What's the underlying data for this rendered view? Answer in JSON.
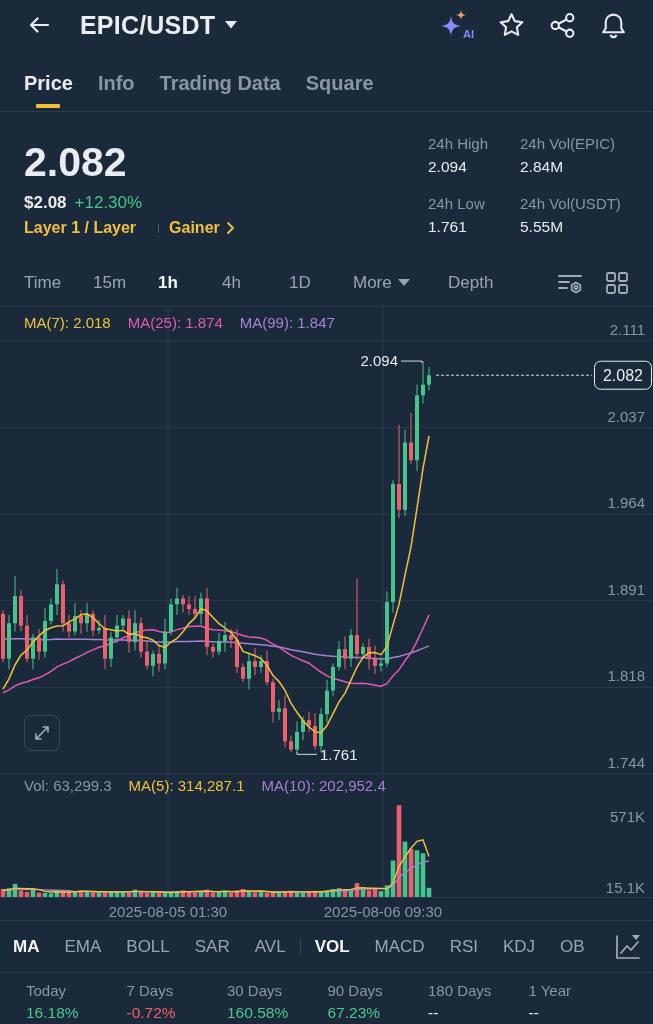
{
  "header": {
    "title": "EPIC/USDT",
    "ai_label": "AI"
  },
  "tabs": [
    {
      "label": "Price",
      "selected": true
    },
    {
      "label": "Info",
      "selected": false
    },
    {
      "label": "Trading Data",
      "selected": false
    },
    {
      "label": "Square",
      "selected": false
    }
  ],
  "ticker": {
    "last_price": "2.082",
    "fiat_price": "$2.08",
    "change": {
      "text": "+12.30%",
      "color": "#45c48b"
    },
    "tags": [
      {
        "label": "Layer 1 / Layer",
        "kind": "category"
      },
      {
        "label": "Gainer",
        "kind": "link"
      }
    ]
  },
  "stats": [
    {
      "label": "24h High",
      "value": "2.094"
    },
    {
      "label": "24h Vol(EPIC)",
      "value": "2.84M"
    },
    {
      "label": "24h Low",
      "value": "1.761"
    },
    {
      "label": "24h Vol(USDT)",
      "value": "5.55M"
    }
  ],
  "intervals": [
    {
      "label": "Time",
      "selected": false,
      "kind": "option"
    },
    {
      "label": "15m",
      "selected": false,
      "kind": "option"
    },
    {
      "label": "1h",
      "selected": true,
      "kind": "option"
    },
    {
      "label": "4h",
      "selected": false,
      "kind": "option"
    },
    {
      "label": "1D",
      "selected": false,
      "kind": "option"
    },
    {
      "label": "More",
      "selected": false,
      "kind": "dropdown"
    },
    {
      "label": "Depth",
      "selected": false,
      "kind": "option"
    }
  ],
  "price_chart": {
    "legend": [
      {
        "text": "MA(7): 2.018",
        "color": "#f0c23a"
      },
      {
        "text": "MA(25): 1.874",
        "color": "#e25ab5"
      },
      {
        "text": "MA(99): 1.847",
        "color": "#a681d4"
      }
    ],
    "axis_labels": [
      "2.111",
      "2.037",
      "1.964",
      "1.891",
      "1.818",
      "1.744"
    ],
    "high_label": "2.094",
    "low_label": "1.761",
    "current_price": "2.082"
  },
  "volume_chart": {
    "legend": [
      {
        "text": "Vol: 63,299.3",
        "color": "#8a96a3"
      },
      {
        "text": "MA(5): 314,287.1",
        "color": "#f0c23a"
      },
      {
        "text": "MA(10): 202,952.4",
        "color": "#a681d4"
      }
    ],
    "axis_labels": [
      "571K",
      "15.1K"
    ],
    "time_labels": [
      "2025-08-05 01:30",
      "2025-08-06 09:30"
    ]
  },
  "indicators": {
    "main": [
      {
        "label": "MA",
        "selected": true
      },
      {
        "label": "EMA",
        "selected": false
      },
      {
        "label": "BOLL",
        "selected": false
      },
      {
        "label": "SAR",
        "selected": false
      },
      {
        "label": "AVL",
        "selected": false
      }
    ],
    "sub": [
      {
        "label": "VOL",
        "selected": true
      },
      {
        "label": "MACD",
        "selected": false
      },
      {
        "label": "RSI",
        "selected": false
      },
      {
        "label": "KDJ",
        "selected": false
      },
      {
        "label": "OB",
        "selected": false
      }
    ]
  },
  "performance": [
    {
      "period": "Today",
      "value": "16.18%",
      "color": "#4cc88f"
    },
    {
      "period": "7 Days",
      "value": "-0.72%",
      "color": "#f0606e"
    },
    {
      "period": "30 Days",
      "value": "160.58%",
      "color": "#4cc88f"
    },
    {
      "period": "90 Days",
      "value": "67.23%",
      "color": "#4cc88f"
    },
    {
      "period": "180 Days",
      "value": "--",
      "color": "#eaecef"
    },
    {
      "period": "1 Year",
      "value": "--",
      "color": "#eaecef"
    }
  ]
}
